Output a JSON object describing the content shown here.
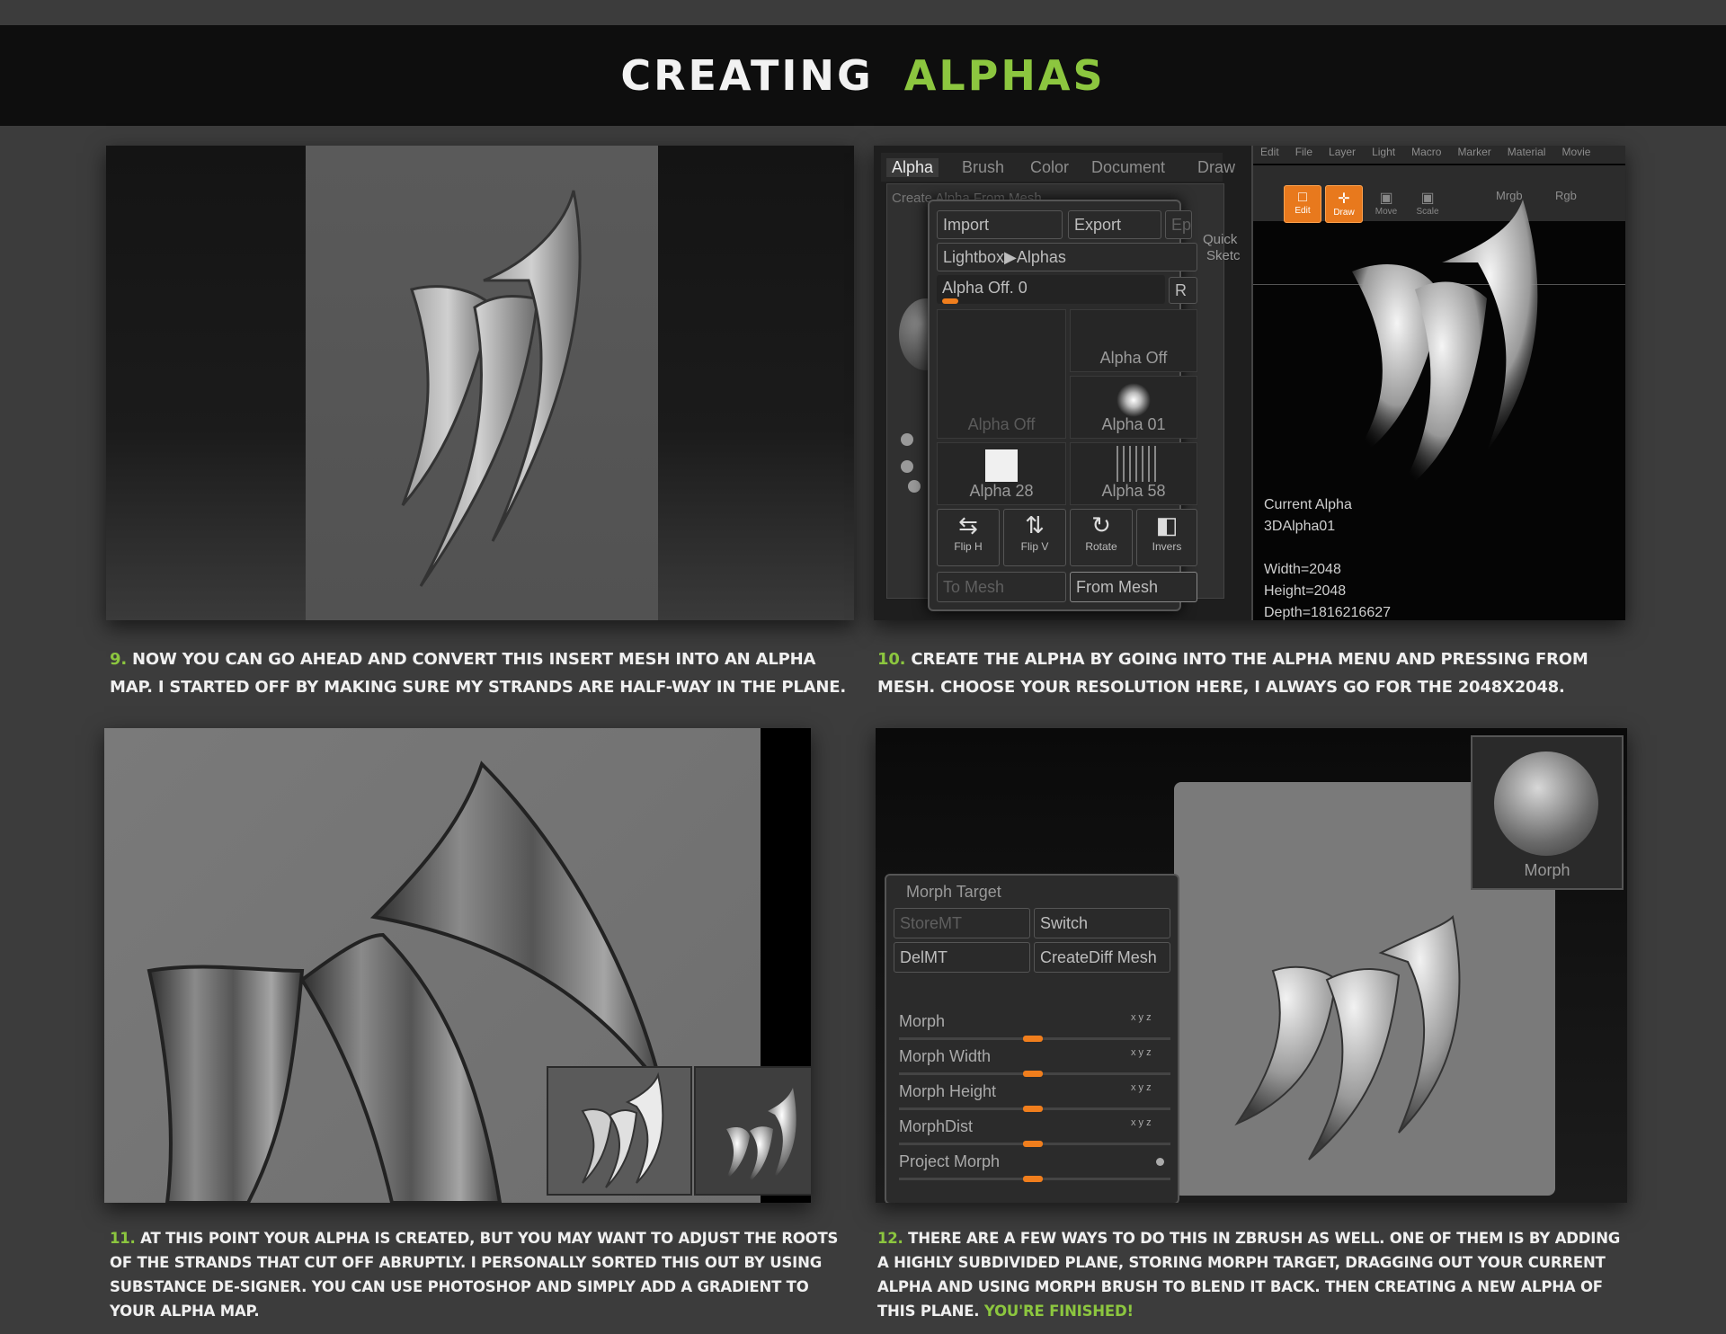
{
  "header": {
    "title_white": "CREATING",
    "title_green": "ALPHAS"
  },
  "step9": {
    "num": "9.",
    "text": " NOW YOU CAN GO AHEAD AND CONVERT THIS INSERT MESH INTO AN ALPHA MAP. I STARTED OFF BY MAKING SURE MY STRANDS ARE HALF-WAY IN THE PLANE."
  },
  "step10": {
    "num": "10.",
    "text": " CREATE THE ALPHA BY GOING INTO THE ALPHA MENU AND PRESSING FROM MESH. CHOOSE YOUR RESOLUTION HERE, I ALWAYS GO FOR THE 2048X2048.",
    "tabs": [
      "Alpha",
      "Brush",
      "Color",
      "Document",
      "Draw"
    ],
    "top_menu": [
      "Edit",
      "File",
      "Layer",
      "Light",
      "Macro",
      "Marker",
      "Material",
      "Movie"
    ],
    "tools": [
      "Edit",
      "Draw",
      "Move",
      "Scale"
    ],
    "top_right": [
      "Mrgb",
      "Rgb"
    ],
    "overlay_title": "Create Alpha From Mesh",
    "import_label": "Import",
    "export_label": "Export",
    "ep_label": "Ep",
    "lightbox_label": "Lightbox▶Alphas",
    "alpha_off_slider": "Alpha Off. 0",
    "r_label": "R",
    "thumbs": [
      "Alpha Off",
      "Alpha Off",
      "Alpha 01",
      "Alpha 28",
      "Alpha 58"
    ],
    "actions": [
      "Flip H",
      "Flip V",
      "Rotate",
      "Invers"
    ],
    "to_mesh": "To Mesh",
    "from_mesh": "From Mesh",
    "side_quick": "Quick",
    "side_sketch": "Sketc",
    "info": [
      "Current Alpha",
      "3DAlpha01",
      "",
      "Width=2048",
      "Height=2048",
      "Depth=1816216627"
    ]
  },
  "step11": {
    "num": "11.",
    "text": " AT THIS POINT YOUR ALPHA IS CREATED, BUT YOU MAY WANT TO ADJUST THE ROOTS OF THE STRANDS THAT CUT OFF ABRUPTLY. I PERSONALLY SORTED THIS OUT BY USING SUBSTANCE DE-SIGNER. YOU CAN USE PHOTOSHOP AND SIMPLY ADD A GRADIENT TO YOUR ALPHA MAP."
  },
  "step12": {
    "num": "12.",
    "text": " THERE ARE A FEW WAYS TO DO THIS IN ZBRUSH AS WELL. ONE OF THEM IS BY ADDING A HIGHLY SUBDIVIDED PLANE, STORING MORPH TARGET, DRAGGING OUT YOUR CURRENT ALPHA AND USING MORPH BRUSH TO BLEND IT BACK. THEN CREATING A NEW ALPHA OF THIS PLANE. ",
    "finished": "YOU'RE FINISHED!",
    "panel_title": "Morph Target",
    "store_mt": "StoreMT",
    "switch": "Switch",
    "del_mt": "DelMT",
    "create_diff": "CreateDiff Mesh",
    "sliders": [
      "Morph",
      "Morph Width",
      "Morph Height",
      "MorphDist",
      "Project Morph"
    ],
    "xyz": "x y z",
    "morph_brush_label": "Morph"
  },
  "colors": {
    "accent_green": "#8cc63f",
    "orange": "#f07e1d",
    "background": "#3c3c3c"
  }
}
